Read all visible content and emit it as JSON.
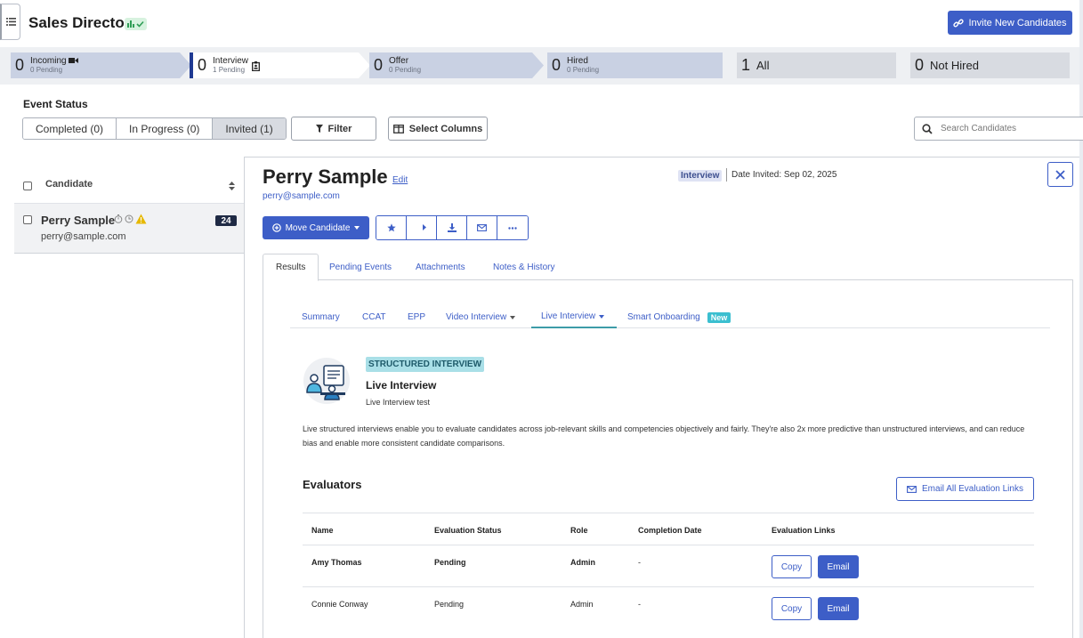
{
  "header": {
    "title": "Sales Director",
    "invite_label": "Invite New Candidates"
  },
  "pipeline": [
    {
      "count": "0",
      "name": "Incoming",
      "sub": "0 Pending",
      "icon": "video-camera-icon"
    },
    {
      "count": "0",
      "name": "Interview",
      "sub": "1 Pending",
      "icon": "id-badge-icon",
      "active": true
    },
    {
      "count": "0",
      "name": "Offer",
      "sub": "0 Pending"
    },
    {
      "count": "0",
      "name": "Hired",
      "sub": "0 Pending"
    },
    {
      "count": "1",
      "name": "All"
    },
    {
      "count": "0",
      "name": "Not Hired"
    }
  ],
  "event_status": {
    "label": "Event Status",
    "options": [
      "Completed (0)",
      "In Progress (0)",
      "Invited (1)"
    ],
    "selected": "Invited (1)"
  },
  "toolbar": {
    "filter_label": "Filter",
    "columns_label": "Select Columns",
    "search_placeholder": "Search Candidates"
  },
  "candidate_list": {
    "column_label": "Candidate",
    "items": [
      {
        "name": "Perry Sample",
        "email": "perry@sample.com",
        "score": "24"
      }
    ]
  },
  "detail": {
    "name": "Perry Sample",
    "edit_label": "Edit",
    "email": "perry@sample.com",
    "stage_badge": "Interview",
    "date_invited": "Date Invited: Sep 02, 2025",
    "move_label": "Move Candidate",
    "tabs": [
      "Results",
      "Pending Events",
      "Attachments",
      "Notes & History"
    ],
    "active_tab": "Results",
    "subtabs": [
      "Summary",
      "CCAT",
      "EPP",
      "Video Interview",
      "Live Interview",
      "Smart Onboarding"
    ],
    "active_subtab": "Live Interview",
    "new_badge": "New",
    "section": {
      "badge": "STRUCTURED INTERVIEW",
      "title": "Live Interview",
      "subtitle": "Live Interview test",
      "description": "Live structured interviews enable you to evaluate candidates across job-relevant skills and competencies objectively and fairly. They're also 2x more predictive than unstructured interviews, and can reduce bias and enable more consistent candidate comparisons."
    },
    "evaluators": {
      "title": "Evaluators",
      "email_all_label": "Email All Evaluation Links",
      "columns": [
        "Name",
        "Evaluation Status",
        "Role",
        "Completion Date",
        "Evaluation Links"
      ],
      "rows": [
        {
          "name": "Amy Thomas",
          "status": "Pending",
          "role": "Admin",
          "date": "-"
        },
        {
          "name": "Connie Conway",
          "status": "Pending",
          "role": "Admin",
          "date": "-"
        }
      ],
      "copy_label": "Copy",
      "email_label": "Email"
    }
  },
  "colors": {
    "primary": "#3d5ec7",
    "stage_fill": "#c9d1e3",
    "teal": "#3bbfd0",
    "warning": "#e6b800"
  }
}
